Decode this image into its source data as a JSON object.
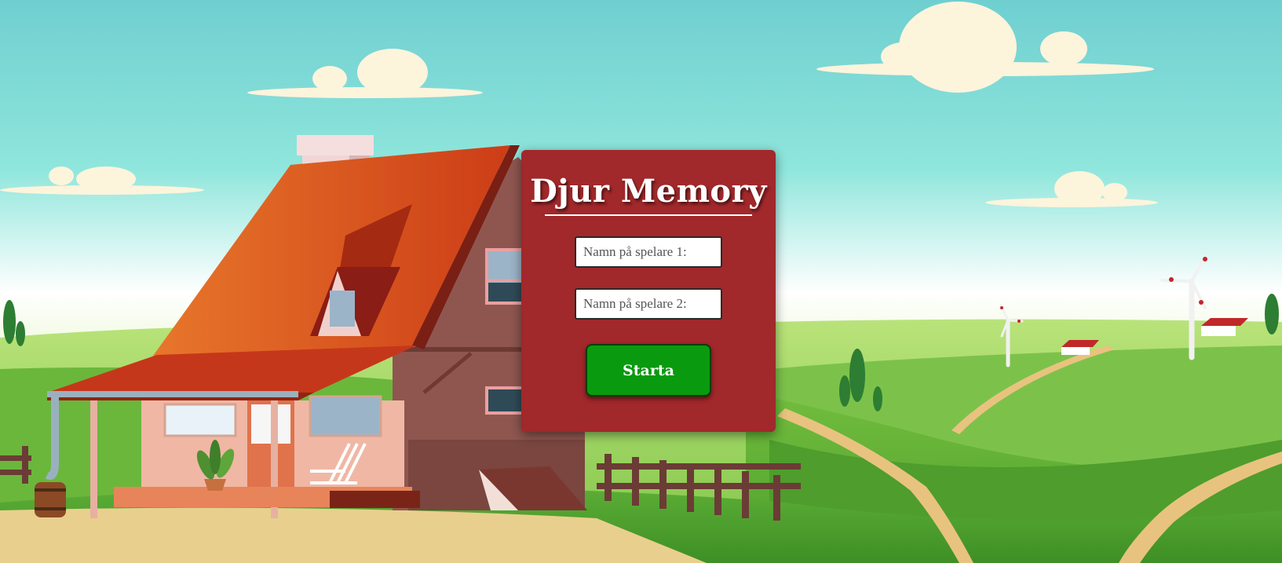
{
  "login": {
    "title": "Djur Memory",
    "player1_placeholder": "Namn på spelare 1:",
    "player2_placeholder": "Namn på spelare 2:",
    "player1_value": "",
    "player2_value": "",
    "start_label": "Starta"
  },
  "colors": {
    "card_background": "#a1282b",
    "start_button": "#0a9a0f",
    "sky_top": "#6fcfd0",
    "sky_bottom": "#ffffff",
    "grass": "#5fb33a",
    "roof": "#d8471c"
  },
  "background": {
    "scene": "farm-landscape",
    "elements": [
      "clouds",
      "farmhouse",
      "hills",
      "windmills",
      "fence",
      "barrel",
      "potted-plant",
      "trees",
      "barns"
    ]
  }
}
